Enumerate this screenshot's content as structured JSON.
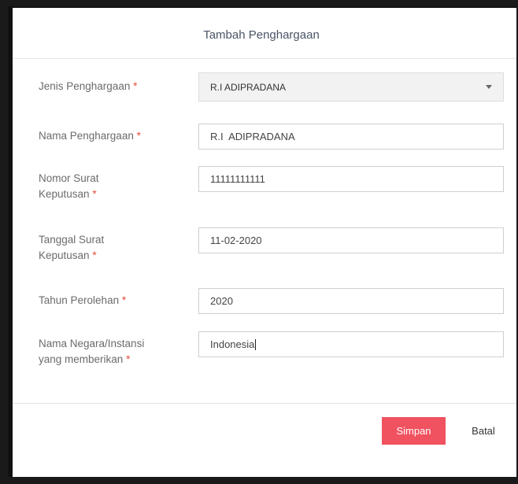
{
  "dialog": {
    "title": "Tambah Penghargaan"
  },
  "form": {
    "jenis": {
      "label": "Jenis Penghargaan",
      "required_mark": "*",
      "selected": "R.I ADIPRADANA"
    },
    "nama": {
      "label": "Nama Penghargaan",
      "required_mark": "*",
      "value": "R.I  ADIPRADANA"
    },
    "nomor": {
      "label_line1": "Nomor Surat",
      "label_line2": "Keputusan",
      "required_mark": "*",
      "value": "11111111111"
    },
    "tanggal": {
      "label_line1": "Tanggal Surat",
      "label_line2": "Keputusan",
      "required_mark": "*",
      "value": "11-02-2020"
    },
    "tahun": {
      "label": "Tahun Perolehan",
      "required_mark": "*",
      "value": "2020"
    },
    "negara": {
      "label_line1": "Nama Negara/Instansi",
      "label_line2": "yang memberikan",
      "required_mark": "*",
      "value": "Indonesia"
    }
  },
  "footer": {
    "save_label": "Simpan",
    "cancel_label": "Batal"
  },
  "colors": {
    "accent": "#f0525f",
    "required": "#e74c3c"
  }
}
